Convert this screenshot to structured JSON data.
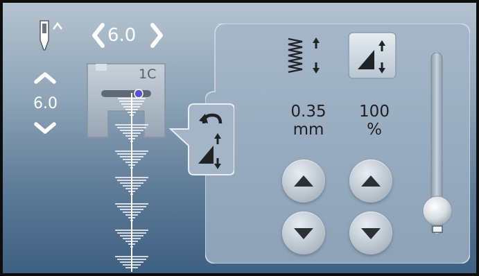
{
  "top_left": {
    "stitch_width": "6.0"
  },
  "left_column": {
    "needle_position_value": "6.0"
  },
  "presser_foot": {
    "code": "1C"
  },
  "panel": {
    "left_value": "0.35",
    "left_unit": "mm",
    "right_value": "100",
    "right_unit": "%"
  },
  "icons": {
    "needle": "needle-up-icon",
    "width_left": "chevron-left-icon",
    "width_right": "chevron-right-icon",
    "position_up": "chevron-up-icon",
    "position_down": "chevron-down-icon",
    "density": "stitch-density-icon",
    "balance": "pattern-length-icon",
    "reset": "reset-arrow-icon"
  },
  "colors": {
    "background_top": "#b5c3cf",
    "background_bottom": "#3f5f80",
    "panel": "#a3b5c6",
    "button_arrow": "#2d3134",
    "foot_marker": "#5b4fd6"
  },
  "slider": {
    "level": 0.1
  }
}
